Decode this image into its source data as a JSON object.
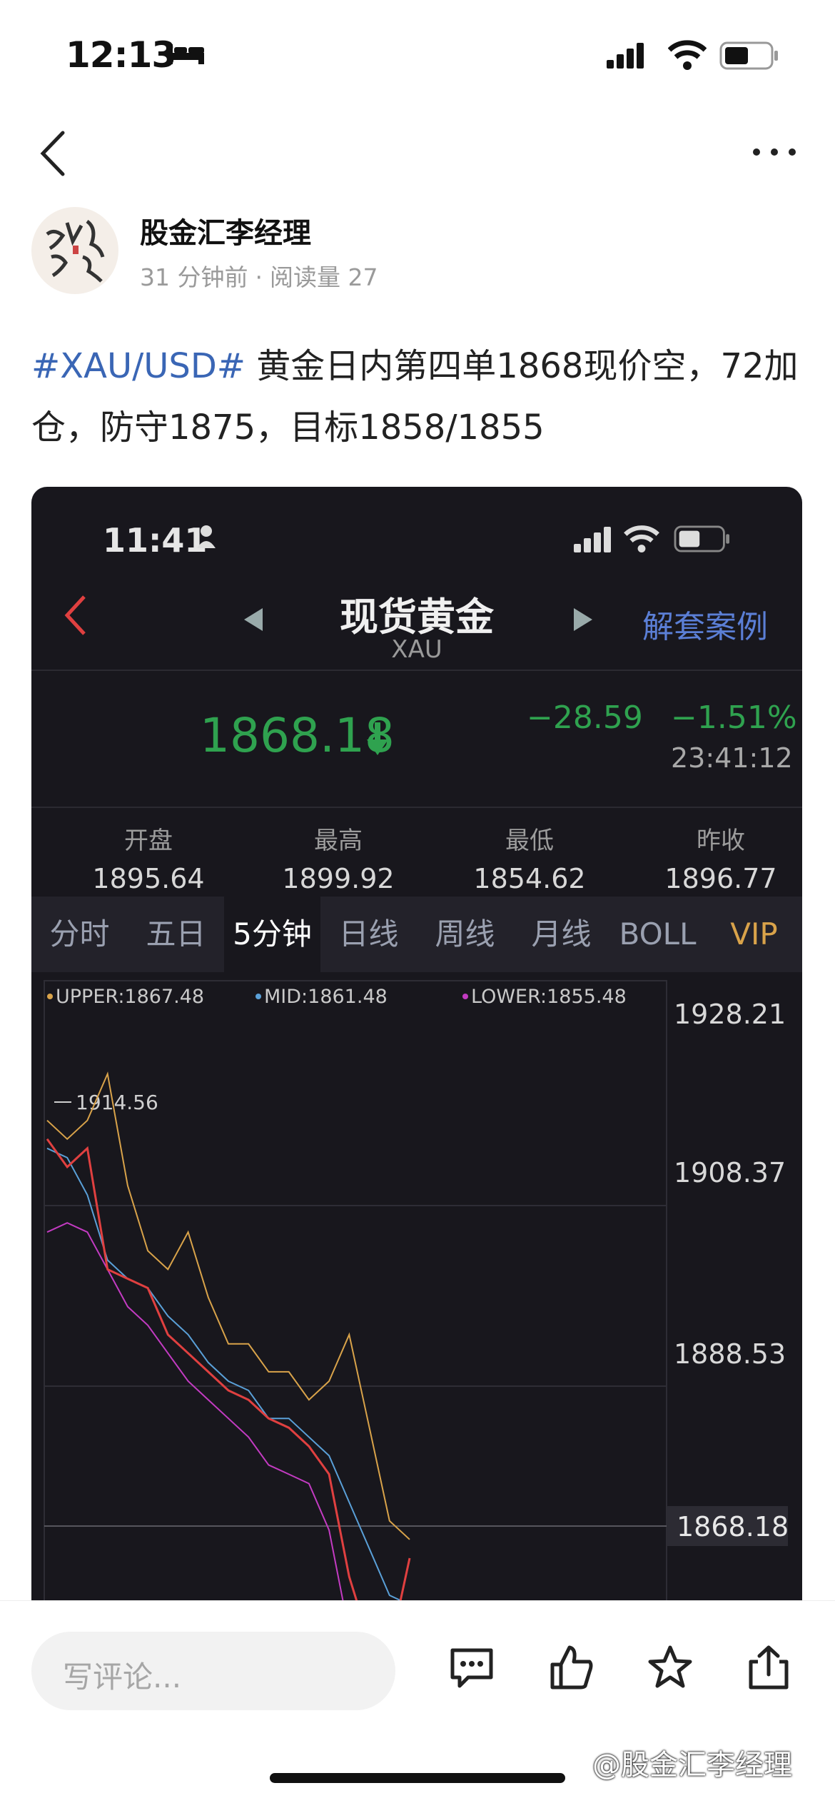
{
  "status_bar": {
    "time": "12:13"
  },
  "author": {
    "name": "股金汇李经理",
    "time_ago": "31 分钟前",
    "sep": "·",
    "reads": "阅读量 27"
  },
  "post": {
    "tag": "#XAU/USD#",
    "text": " 黄金日内第四单1868现价空，72加仓，防守1875，目标1858/1855"
  },
  "embedded": {
    "time": "11:41",
    "title": "现货黄金",
    "subtitle": "XAU",
    "right_link": "解套案例",
    "price": "1868.18",
    "change": "−28.59",
    "change_pct": "−1.51%",
    "timestamp": "23:41:12",
    "stats": [
      {
        "label": "开盘",
        "value": "1895.64"
      },
      {
        "label": "最高",
        "value": "1899.92"
      },
      {
        "label": "最低",
        "value": "1854.62"
      },
      {
        "label": "昨收",
        "value": "1896.77"
      }
    ],
    "tabs": [
      "分时",
      "五日",
      "5分钟",
      "日线",
      "周线",
      "月线",
      "BOLL",
      "VIP"
    ],
    "active_tab": "5分钟",
    "colors": {
      "up": "#e04040",
      "down": "#2fa24f",
      "upper": "#d9a34a",
      "mid": "#5aa0d8",
      "lower": "#c33bc2"
    }
  },
  "chart_data": {
    "type": "line",
    "legend": [
      {
        "name": "UPPER",
        "label": "UPPER:1867.48"
      },
      {
        "name": "MID",
        "label": "MID:1861.48"
      },
      {
        "name": "LOWER",
        "label": "LOWER:1855.48"
      }
    ],
    "y_ticks": [
      "1928.21",
      "1908.37",
      "1888.53",
      "1868.18"
    ],
    "ylim": [
      1865,
      1930
    ],
    "high_annotation": "1914.56",
    "current_price": 1868.18,
    "series": [
      {
        "name": "UPPER",
        "values": [
          1915,
          1913,
          1915,
          1920,
          1908,
          1901,
          1899,
          1903,
          1896,
          1891,
          1891,
          1888,
          1888,
          1885,
          1887,
          1892,
          1882,
          1872,
          1870
        ]
      },
      {
        "name": "MID",
        "values": [
          1912,
          1911,
          1907,
          1900,
          1898,
          1897,
          1894,
          1892,
          1889,
          1887,
          1886,
          1883,
          1883,
          1881,
          1879,
          1874,
          1869,
          1864,
          1863
        ]
      },
      {
        "name": "LOWER",
        "values": [
          1903,
          1904,
          1903,
          1899,
          1895,
          1893,
          1890,
          1887,
          1885,
          1883,
          1881,
          1878,
          1877,
          1876,
          1871,
          1860,
          1856,
          1858,
          1855
        ]
      },
      {
        "name": "PRICE",
        "values": [
          1913,
          1910,
          1912,
          1899,
          1898,
          1897,
          1892,
          1890,
          1888,
          1886,
          1885,
          1883,
          1882,
          1880,
          1877,
          1866,
          1859,
          1858,
          1868
        ]
      }
    ]
  },
  "bottom_bar": {
    "comment_placeholder": "写评论..."
  },
  "watermark": "@股金汇李经理"
}
